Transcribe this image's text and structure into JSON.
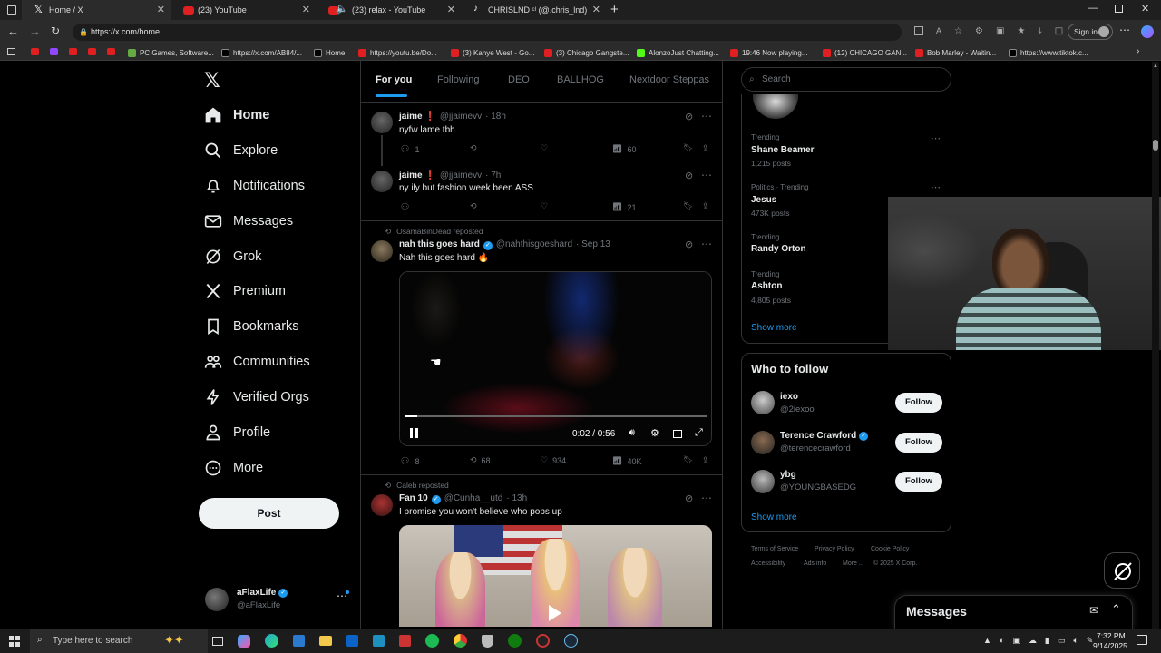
{
  "browser": {
    "tabs": [
      {
        "title": "Home / X"
      },
      {
        "title": "(23) YouTube"
      },
      {
        "title": "(23) relax - YouTube"
      },
      {
        "title": "CHRISLND ᶜˡ (@.chris_lnd) | TikTo"
      }
    ],
    "url": "https://x.com/home",
    "sign_in": "Sign in",
    "bookmarks": [
      "PC Games, Software...",
      "https://x.com/AB84/...",
      "Home",
      "https://youtu.be/Do...",
      "(3) Kanye West - Go...",
      "(3) Chicago Gangste...",
      "AlonzoJust Chatting...",
      "19:46 Now playing...",
      "(12) CHICAGO GAN...",
      "Bob Marley - Waitin...",
      "https://www.tiktok.c..."
    ]
  },
  "nav": {
    "items": [
      "Home",
      "Explore",
      "Notifications",
      "Messages",
      "Grok",
      "Premium",
      "Bookmarks",
      "Communities",
      "Verified Orgs",
      "Profile",
      "More"
    ],
    "post": "Post",
    "user_name": "aFlaxLife",
    "user_handle": "@aFlaxLife"
  },
  "feed": {
    "tabs": [
      "For you",
      "Following",
      "DEO",
      "BALLHOG",
      "Nextdoor Steppas"
    ],
    "tweets": [
      {
        "name": "jaime ❗",
        "handle": "@jjaimevv",
        "time": "· 18h",
        "text": "nyfw lame tbh",
        "replies": "1",
        "reposts": "",
        "likes": "",
        "views": "60"
      },
      {
        "name": "jaime ❗",
        "handle": "@jjaimevv",
        "time": "· 7h",
        "text": "ny ily but fashion week been ASS",
        "replies": "",
        "reposts": "",
        "likes": "",
        "views": "21"
      },
      {
        "reposted_by": "OsamaBinDead reposted",
        "name": "nah this goes hard",
        "handle": "@nahthisgoeshard",
        "time": "· Sep 13",
        "text": "Nah this goes hard 🔥",
        "video_time": "0:02 / 0:56",
        "progress": 0.04,
        "replies": "8",
        "reposts": "68",
        "likes": "934",
        "views": "40K"
      },
      {
        "reposted_by": "Caleb reposted",
        "name": "Fan 10",
        "handle": "@Cunha__utd",
        "time": "· 13h",
        "text": "I promise you won't believe who pops up"
      }
    ]
  },
  "right": {
    "search_placeholder": "Search",
    "trends": [
      {
        "category": "Trending",
        "name": "Shane Beamer",
        "count": "1,215 posts"
      },
      {
        "category": "Politics · Trending",
        "name": "Jesus",
        "count": "473K posts"
      },
      {
        "category": "Trending",
        "name": "Randy Orton",
        "count": ""
      },
      {
        "category": "Trending",
        "name": "Ashton",
        "count": "4,805 posts"
      }
    ],
    "show_more": "Show more",
    "who_to_follow": "Who to follow",
    "follow_suggestions": [
      {
        "name": "iexo",
        "handle": "@2iexoo"
      },
      {
        "name": "Terence Crawford",
        "handle": "@terencecrawford"
      },
      {
        "name": "ybg",
        "handle": "@YOUNGBASEDG"
      }
    ],
    "follow_label": "Follow",
    "footer": [
      "Terms of Service",
      "Privacy Policy",
      "Cookie Policy",
      "Accessibility",
      "Ads info",
      "More ...",
      "© 2025 X Corp."
    ],
    "messages": "Messages"
  },
  "taskbar": {
    "search_placeholder": "Type here to search",
    "time": "7:32 PM",
    "date": "9/14/2025"
  }
}
